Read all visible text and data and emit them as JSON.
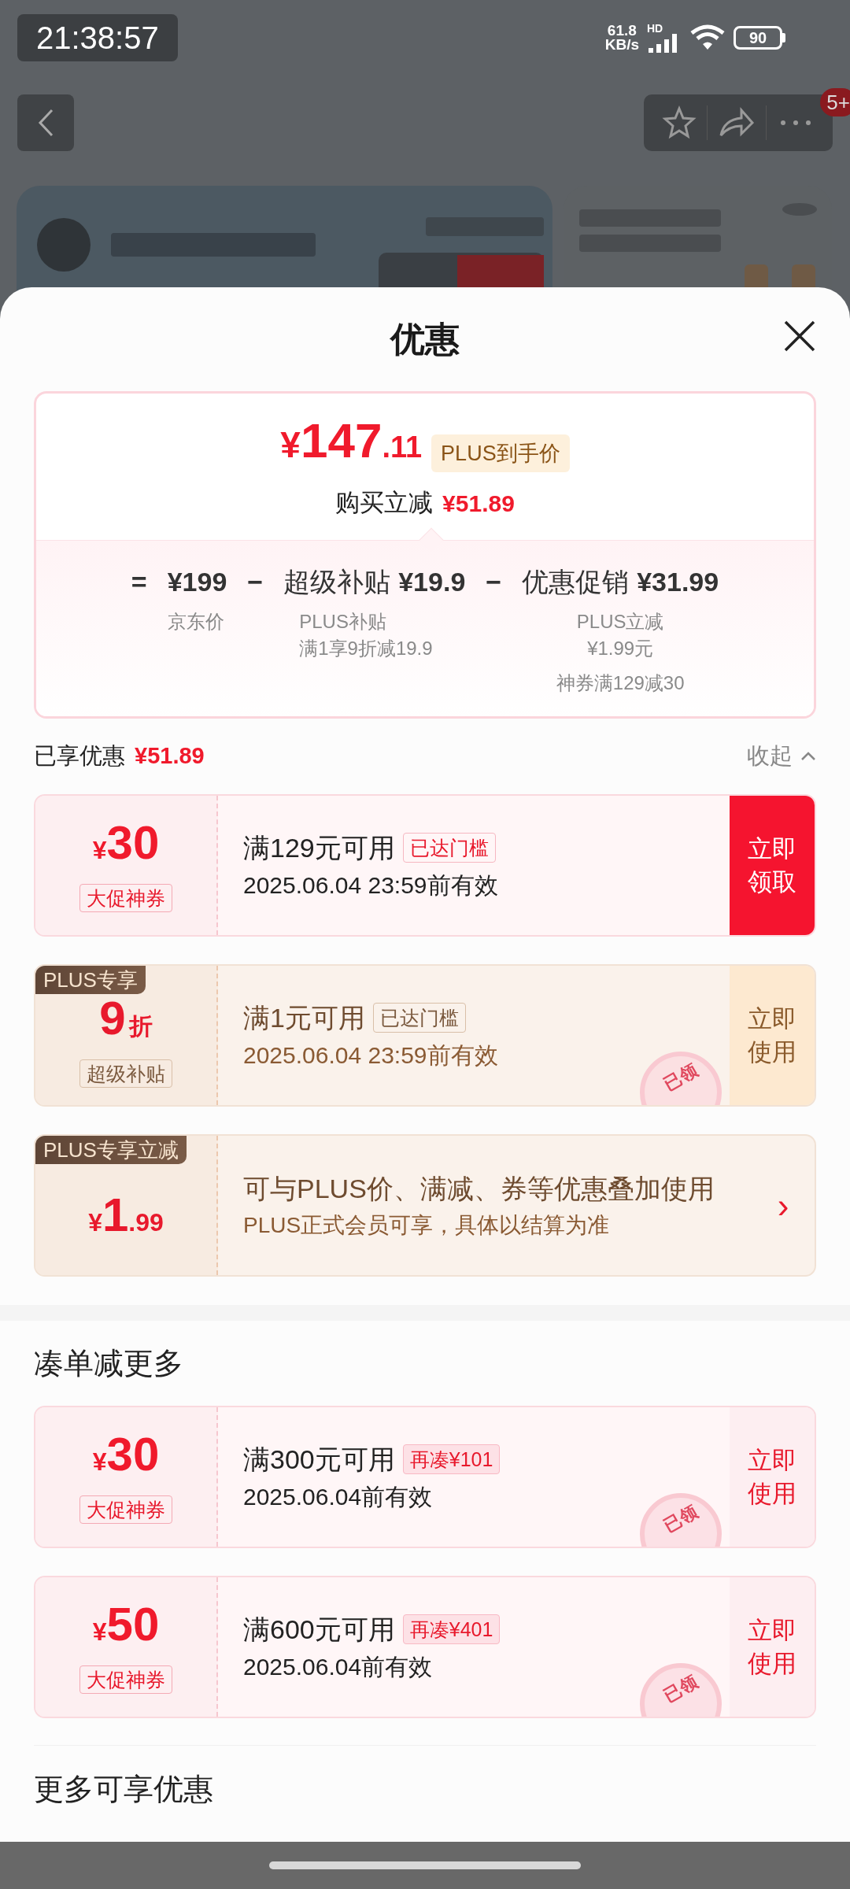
{
  "status_bar": {
    "time": "21:38:57",
    "speed_value": "61.8",
    "speed_unit": "KB/s",
    "network": "HD",
    "battery": "90"
  },
  "top_bar": {
    "badge": "5+"
  },
  "sheet": {
    "title": "优惠"
  },
  "price_summary": {
    "currency": "¥",
    "price_int": "147",
    "price_dec": ".11",
    "price_tag": "PLUS到手价",
    "saving_label": "购买立减",
    "saving": "¥51.89",
    "breakdown": [
      {
        "operator": "=",
        "amount": "¥199",
        "notes": [
          "京东价"
        ]
      },
      {
        "operator": "−",
        "label": "超级补贴",
        "amount": "¥19.9",
        "notes": [
          "PLUS补贴",
          "满1享9折减19.9"
        ]
      },
      {
        "operator": "−",
        "label": "优惠促销",
        "amount": "¥31.99",
        "notes": [
          "PLUS立减",
          "¥1.99元",
          "神券满129减30"
        ]
      }
    ]
  },
  "enjoyed": {
    "label": "已享优惠",
    "amount": "¥51.89",
    "toggle": "收起",
    "expanded": true
  },
  "coupons": [
    {
      "kind": "amount",
      "plus": false,
      "currency": "¥",
      "value": "30",
      "tag": "大促神券",
      "condition": "满129元可用",
      "status": "已达门槛",
      "threshold_met": true,
      "validity": "2025.06.04 23:59前有效",
      "action": "立即领取",
      "claimed": false
    },
    {
      "kind": "discount",
      "plus": true,
      "ribbon": "PLUS专享",
      "value": "9",
      "unit": "折",
      "tag": "超级补贴",
      "condition": "满1元可用",
      "status": "已达门槛",
      "threshold_met": true,
      "validity": "2025.06.04 23:59前有效",
      "action": "立即使用",
      "claimed": true,
      "stamp": "已领"
    },
    {
      "kind": "cut",
      "plus": true,
      "ribbon": "PLUS专享立减",
      "currency": "¥",
      "value": "1",
      "decimal": ".99",
      "title": "可与PLUS价、满减、券等优惠叠加使用",
      "subtitle": "PLUS正式会员可享，具体以结算为准",
      "chevron": "›"
    }
  ],
  "more_section": {
    "title": "凑单减更多",
    "coupons": [
      {
        "kind": "amount",
        "plus": false,
        "currency": "¥",
        "value": "30",
        "tag": "大促神券",
        "condition": "满300元可用",
        "status": "再凑¥101",
        "threshold_met": false,
        "validity": "2025.06.04前有效",
        "action": "立即使用",
        "claimed": true,
        "stamp": "已领"
      },
      {
        "kind": "amount",
        "plus": false,
        "currency": "¥",
        "value": "50",
        "tag": "大促神券",
        "condition": "满600元可用",
        "status": "再凑¥401",
        "threshold_met": false,
        "validity": "2025.06.04前有效",
        "action": "立即使用",
        "claimed": true,
        "stamp": "已领"
      }
    ]
  },
  "footer_section": {
    "title": "更多可享优惠"
  }
}
